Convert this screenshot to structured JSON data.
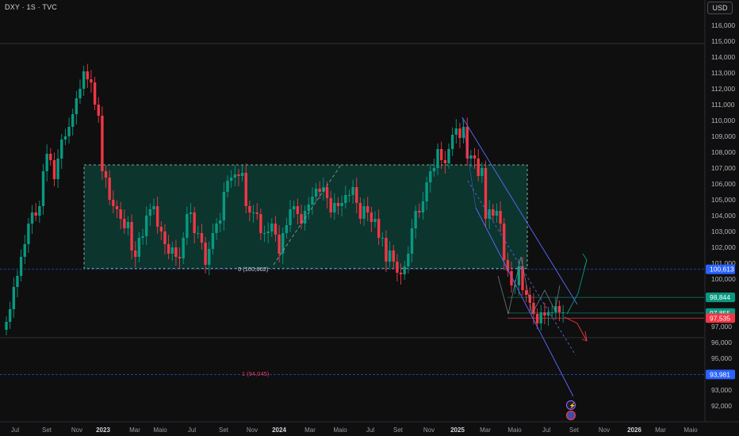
{
  "header": {
    "symbol": "DXY · 1S · TVC",
    "currency_button": "USD"
  },
  "chart_data": {
    "type": "candlestick",
    "ylim": [
      91.3,
      116.9
    ],
    "y_ticks": [
      92,
      93,
      94,
      95,
      96,
      97,
      98,
      99,
      100,
      101,
      102,
      103,
      104,
      105,
      106,
      107,
      108,
      109,
      110,
      111,
      112,
      113,
      114,
      115,
      116
    ],
    "x_ticks": [
      "Jul",
      "Set",
      "Nov",
      "2023",
      "Mar",
      "Maio",
      "Jul",
      "Set",
      "Nov",
      "2024",
      "Mar",
      "Maio",
      "Jul",
      "Set",
      "Nov",
      "2025",
      "Mar",
      "Maio",
      "Jul",
      "Set",
      "Nov",
      "2026",
      "Mar",
      "Maio"
    ],
    "x_ticks_bold": [
      "2023",
      "2024",
      "2025",
      "2026"
    ],
    "price_labels": [
      {
        "text": "100,613",
        "value": 100.613,
        "color": "#2962ff"
      },
      {
        "text": "98,844",
        "value": 98.844,
        "color": "#089981"
      },
      {
        "text": "97,855",
        "value": 97.855,
        "color": "#089981"
      },
      {
        "text": "97,535",
        "value": 97.535,
        "color": "#f23645"
      },
      {
        "text": "93,981",
        "value": 93.981,
        "color": "#2962ff"
      }
    ],
    "range_box": {
      "top": 107.2,
      "bottom": 100.662
    },
    "fib_labels": [
      {
        "text": "0 (100,662)",
        "value": 100.662
      },
      {
        "text": "1 (94,045)",
        "value": 94.045
      }
    ],
    "close_series": [
      97.3,
      98.1,
      99.5,
      100.2,
      101.4,
      102.2,
      103.5,
      104.2,
      104.0,
      104.6,
      106.8,
      107.9,
      107.5,
      106.3,
      107.6,
      108.8,
      109.0,
      109.6,
      110.4,
      111.4,
      112.0,
      113.1,
      112.6,
      112.4,
      111.0,
      110.3,
      106.8,
      106.4,
      105.0,
      104.6,
      104.4,
      103.8,
      103.2,
      103.6,
      101.8,
      101.4,
      102.6,
      102.7,
      104.0,
      104.4,
      104.6,
      103.3,
      103.0,
      102.2,
      101.6,
      102.0,
      101.4,
      101.3,
      102.6,
      104.1,
      104.2,
      102.9,
      102.9,
      102.3,
      100.9,
      101.9,
      102.9,
      103.5,
      103.7,
      105.5,
      106.2,
      106.4,
      106.6,
      106.5,
      106.7,
      104.6,
      104.2,
      104.2,
      104.1,
      102.9,
      102.9,
      103.0,
      103.5,
      102.8,
      101.6,
      102.9,
      103.4,
      104.4,
      104.6,
      104.1,
      103.5,
      104.3,
      104.7,
      105.2,
      105.7,
      105.5,
      105.8,
      105.1,
      104.2,
      104.8,
      104.6,
      104.8,
      105.3,
      105.3,
      105.8,
      104.8,
      103.8,
      104.6,
      104.2,
      103.6,
      103.8,
      102.6,
      102.6,
      101.1,
      101.8,
      101.1,
      100.4,
      100.3,
      100.8,
      101.6,
      103.2,
      104.3,
      104.2,
      104.9,
      106.1,
      106.8,
      107.0,
      108.2,
      107.5,
      107.3,
      108.2,
      109.1,
      109.5,
      108.9,
      109.6,
      107.6,
      107.8,
      107.6,
      106.5,
      107.0,
      103.8,
      104.4,
      104.0,
      104.3,
      103.5,
      101.2,
      100.5,
      99.6,
      99.6,
      100.8,
      99.3,
      99.0,
      98.5,
      97.8,
      97.2,
      97.9,
      97.7,
      97.9,
      97.9,
      98.3,
      97.9,
      97.9
    ]
  }
}
